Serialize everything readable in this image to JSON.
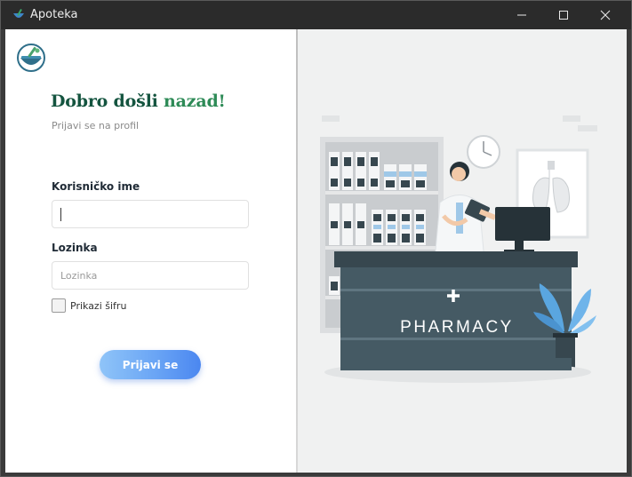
{
  "window": {
    "title": "Apoteka",
    "icons": [
      "app-icon",
      "minimize-icon",
      "maximize-icon",
      "close-icon"
    ]
  },
  "login": {
    "heading_part1": "Dobro došli ",
    "heading_part2": "nazad!",
    "subtitle": "Prijavi se na profil",
    "username_label": "Korisničko ime",
    "username_value": "",
    "password_label": "Lozinka",
    "password_placeholder": "Lozinka",
    "show_password_label": "Prikazi šifru",
    "show_password_checked": false,
    "submit_label": "Prijavi se"
  },
  "illustration": {
    "sign_text": "PHARMACY",
    "icons": [
      "pharmacy-illustration",
      "plus-icon",
      "clock-icon",
      "lungs-xray-icon",
      "plant-icon",
      "monitor-icon"
    ]
  },
  "colors": {
    "heading_dark": "#14543f",
    "heading_green": "#2e8b57",
    "button_start": "#8fc4f8",
    "button_end": "#4b87f0",
    "counter": "#37474f"
  }
}
